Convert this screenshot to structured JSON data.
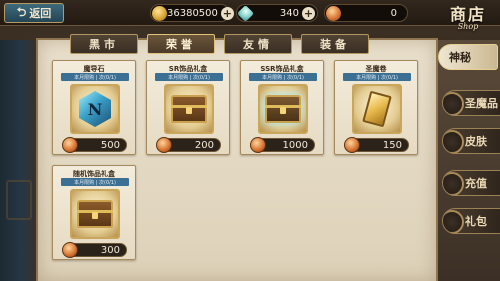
{
  "header": {
    "back_label": "返回",
    "gold": "36380500",
    "gems": "340",
    "honor": "0",
    "shop_title": "商店",
    "shop_title_en": "Shop"
  },
  "tabs": [
    {
      "label": "黑市",
      "active": false
    },
    {
      "label": "荣誉",
      "active": true
    },
    {
      "label": "友情",
      "active": false
    },
    {
      "label": "装备",
      "active": false
    }
  ],
  "items": [
    {
      "name": "魔导石",
      "limit": "本月限购 | 次(0/1)",
      "price": "500",
      "icon": "crystal-icon"
    },
    {
      "name": "SR饰品礼盒",
      "limit": "本月限购 | 次(0/1)",
      "price": "200",
      "icon": "chest-icon"
    },
    {
      "name": "SSR饰品礼盒",
      "limit": "本月限购 | 次(0/1)",
      "price": "1000",
      "icon": "chest-icon"
    },
    {
      "name": "圣魔卷",
      "limit": "本月限购 | 次(0/1)",
      "price": "150",
      "icon": "ticket-icon"
    },
    {
      "name": "随机饰品礼盒",
      "limit": "本月限购 | 次(0/1)",
      "price": "300",
      "icon": "chest-icon"
    }
  ],
  "side_menu": [
    {
      "label": "神秘",
      "active": true
    },
    {
      "label": "圣魔品",
      "active": false
    },
    {
      "label": "皮肤",
      "active": false
    },
    {
      "label": "充值",
      "active": false
    },
    {
      "label": "礼包",
      "active": false
    }
  ],
  "colors": {
    "panel": "#e9e0cd",
    "tab_active": "#6b553b",
    "limit_bar": "#3b6f93"
  }
}
